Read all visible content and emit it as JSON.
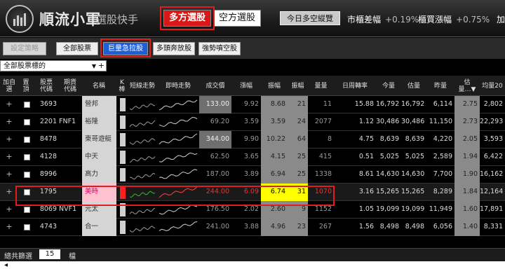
{
  "app": {
    "title": "順流小軍",
    "subtitle": "選股快手",
    "tabs": [
      "多方選股",
      "空方選股"
    ],
    "today_button": "今日多空縱覽",
    "stats": [
      {
        "label": "市櫃差幅",
        "value": "+0.19%"
      },
      {
        "label": "櫃買漲幅",
        "value": "+0.75%"
      },
      {
        "label": "加",
        "value": ""
      }
    ]
  },
  "toolbar": {
    "buttons": [
      "設定策略",
      "全部股票",
      "巨量急拉股",
      "多頭奔放股",
      "強勢噴空股"
    ]
  },
  "filter": {
    "value": "全部股票標的",
    "arrow": "▼",
    "plus": "+"
  },
  "columns": [
    "加自\n選",
    "置\n頂",
    "股票\n代碼",
    "期貨\n代碼",
    "名稱",
    "K\n棒",
    "短線走勢",
    "即時走勢",
    "成交價",
    "漲幅",
    "振幅",
    "振幅",
    "量量",
    "日周轉率",
    "今量",
    "估量",
    "昨量",
    "估\n量…▼",
    "均量20"
  ],
  "rows": [
    {
      "code": "3693",
      "fut": "",
      "name": "營邦",
      "price": "133.00",
      "chg": "9.92",
      "amp": "8.68",
      "n": "21",
      "vol": "11",
      "turn": "15.88",
      "today": "16,792",
      "est": "16,792",
      "yest": "6,114",
      "ratio": "2.75",
      "avg": "2,802"
    },
    {
      "code": "2201",
      "fut": "FNF1",
      "name": "裕隆",
      "price": "69.20",
      "chg": "3.59",
      "amp": "3.59",
      "n": "24",
      "vol": "2077",
      "turn": "1.12",
      "today": "30,486",
      "est": "30,486",
      "yest": "11,150",
      "ratio": "2.73",
      "avg": "22,293"
    },
    {
      "code": "8478",
      "fut": "",
      "name": "東哥遊艇",
      "price": "344.00",
      "chg": "9.90",
      "amp": "10.22",
      "n": "64",
      "vol": "8",
      "turn": "4.75",
      "today": "8,639",
      "est": "8,639",
      "yest": "4,220",
      "ratio": "2.05",
      "avg": "3,593"
    },
    {
      "code": "4128",
      "fut": "",
      "name": "中天",
      "price": "62.50",
      "chg": "3.65",
      "amp": "4.15",
      "n": "25",
      "vol": "415",
      "turn": "0.51",
      "today": "5,025",
      "est": "5,025",
      "yest": "2,589",
      "ratio": "1.94",
      "avg": "6,422"
    },
    {
      "code": "8996",
      "fut": "",
      "name": "高力",
      "price": "187.00",
      "chg": "3.89",
      "amp": "6.94",
      "n": "25",
      "vol": "1338",
      "turn": "8.61",
      "today": "14,630",
      "est": "14,630",
      "yest": "7,700",
      "ratio": "1.90",
      "avg": "16,162"
    },
    {
      "code": "1795",
      "fut": "",
      "name": "美時",
      "price": "244.00",
      "chg": "6.09",
      "amp": "6.74",
      "n": "31",
      "vol": "1070",
      "turn": "3.16",
      "today": "15,265",
      "est": "15,265",
      "yest": "8,289",
      "ratio": "1.84",
      "avg": "12,164"
    },
    {
      "code": "8069",
      "fut": "NVF1",
      "name": "元太",
      "price": "176.50",
      "chg": "2.02",
      "amp": "2.60",
      "n": "9",
      "vol": "1152",
      "turn": "1.05",
      "today": "19,099",
      "est": "19,099",
      "yest": "11,949",
      "ratio": "1.60",
      "avg": "17,891"
    },
    {
      "code": "4743",
      "fut": "",
      "name": "合一",
      "price": "241.00",
      "chg": "3.88",
      "amp": "4.96",
      "n": "23",
      "vol": "267",
      "turn": "1.56",
      "today": "8,498",
      "est": "8,498",
      "yest": "6,056",
      "ratio": "1.40",
      "avg": "8,331"
    }
  ],
  "footer": {
    "label": "總共篩選",
    "count": "15",
    "unit": "檔",
    "caret": "◂"
  },
  "colors": {
    "accent_red": "#d91717",
    "select_blue": "#1f5fd6",
    "highlight_yellow": "#ffff00",
    "up_red": "#ff2a2a"
  }
}
